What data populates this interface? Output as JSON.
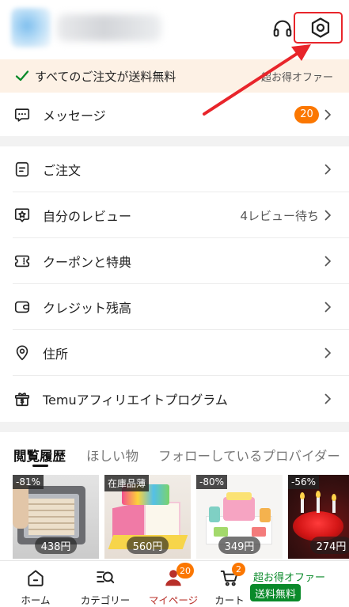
{
  "header": {
    "support_icon": "headset-icon",
    "settings_icon": "gear-icon"
  },
  "banner": {
    "icon": "check-icon",
    "text": "すべてのご注文が送料無料",
    "offer_text": "超お得オファー"
  },
  "messages": {
    "icon": "message-icon",
    "label": "メッセージ",
    "badge": "20"
  },
  "menu": {
    "items": [
      {
        "icon": "order-icon",
        "label": "ご注文"
      },
      {
        "icon": "review-icon",
        "label": "自分のレビュー",
        "detail": "4レビュー待ち"
      },
      {
        "icon": "coupon-icon",
        "label": "クーポンと特典"
      },
      {
        "icon": "credit-icon",
        "label": "クレジット残高"
      },
      {
        "icon": "address-icon",
        "label": "住所"
      },
      {
        "icon": "affiliate-gift-icon",
        "label": "Temuアフィリエイトプログラム"
      }
    ]
  },
  "history": {
    "tabs": [
      {
        "label": "閲覧履歴",
        "active": true
      },
      {
        "label": "ほしい物",
        "active": false
      },
      {
        "label": "フォローしているプロバイダー",
        "active": false
      }
    ],
    "products": [
      {
        "badge": "-81%",
        "price": "438円"
      },
      {
        "badge": "在庫品薄",
        "price": "560円"
      },
      {
        "badge": "-80%",
        "price": "349円"
      },
      {
        "badge": "-56%",
        "price": "274円"
      }
    ]
  },
  "bottom_nav": {
    "items": [
      {
        "icon": "home-icon",
        "label": "ホーム",
        "active": false
      },
      {
        "icon": "category-search-icon",
        "label": "カテゴリー",
        "active": false
      },
      {
        "icon": "person-icon",
        "label": "マイページ",
        "active": true,
        "badge": "20"
      },
      {
        "icon": "cart-icon",
        "label": "カート",
        "active": false,
        "badge": "2"
      }
    ],
    "promo": {
      "text": "超お得オファー",
      "badge": "送料無料"
    }
  },
  "colors": {
    "accent_orange": "#fb7701",
    "active_red": "#b8302a",
    "promo_green": "#0a8a2a",
    "banner_bg": "#fdf1e5",
    "annotation_red": "#e8252b"
  }
}
